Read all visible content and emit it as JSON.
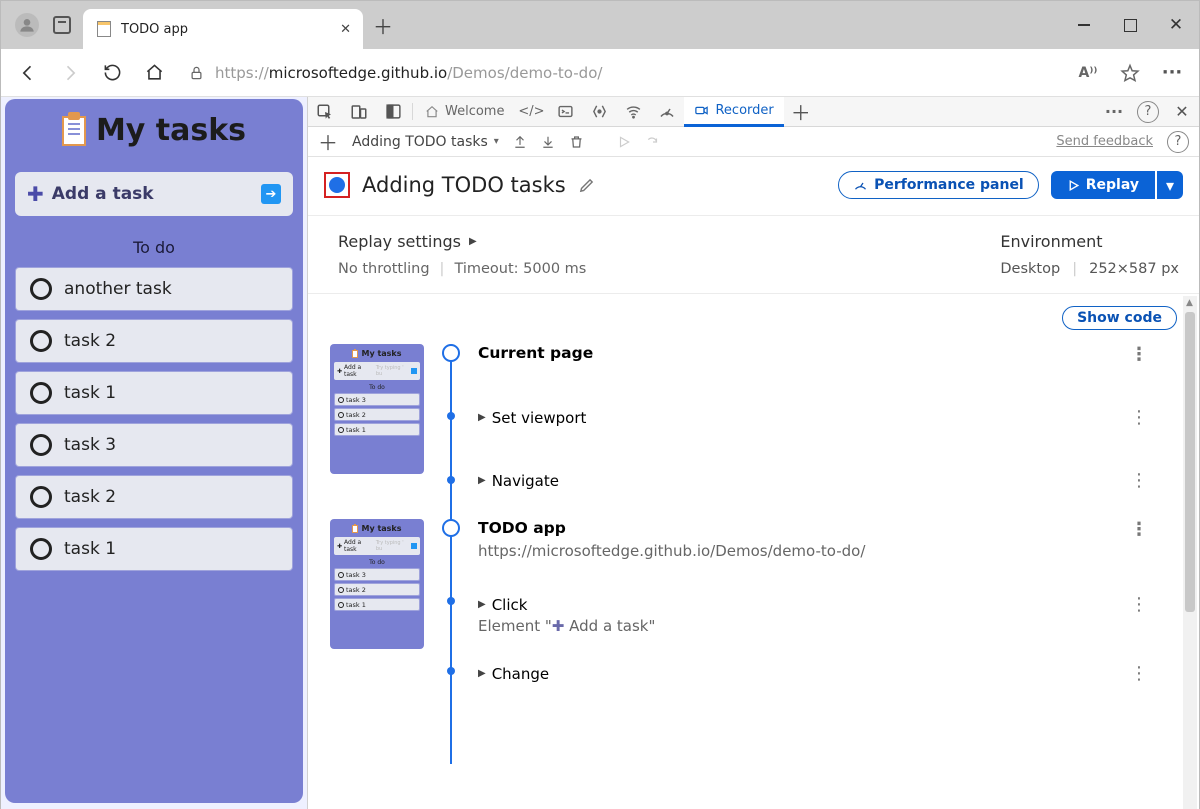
{
  "browser": {
    "tab_title": "TODO app",
    "url_prefix": "https://",
    "url_host": "microsoftedge.github.io",
    "url_path": "/Demos/demo-to-do/"
  },
  "todo_app": {
    "title": "My tasks",
    "add_task": "Add a task",
    "section_todo": "To do",
    "tasks": [
      "another task",
      "task 2",
      "task 1",
      "task 3",
      "task 2",
      "task 1"
    ]
  },
  "devtools": {
    "tabs": {
      "welcome": "Welcome",
      "recorder": "Recorder"
    },
    "recorder": {
      "recording_selector": "Adding TODO tasks",
      "feedback": "Send feedback",
      "title": "Adding TODO tasks",
      "performance_panel": "Performance panel",
      "replay": "Replay",
      "replay_settings": "Replay settings",
      "no_throttling": "No throttling",
      "timeout": "Timeout: 5000 ms",
      "environment": "Environment",
      "env_device": "Desktop",
      "env_size": "252×587 px",
      "show_code": "Show code",
      "steps": {
        "group1": {
          "title": "Current page",
          "sub1": "Set viewport",
          "sub2": "Navigate"
        },
        "group2": {
          "title": "TODO app",
          "url": "https://microsoftedge.github.io/Demos/demo-to-do/",
          "sub1": "Click",
          "sub1_element_pre": "Element \"",
          "sub1_element_text": "Add a task\"",
          "sub2": "Change"
        }
      },
      "thumb_tasks_a": [
        "task 3",
        "task 2",
        "task 1"
      ],
      "thumb_tasks_b": [
        "task 3",
        "task 2",
        "task 1"
      ]
    }
  }
}
